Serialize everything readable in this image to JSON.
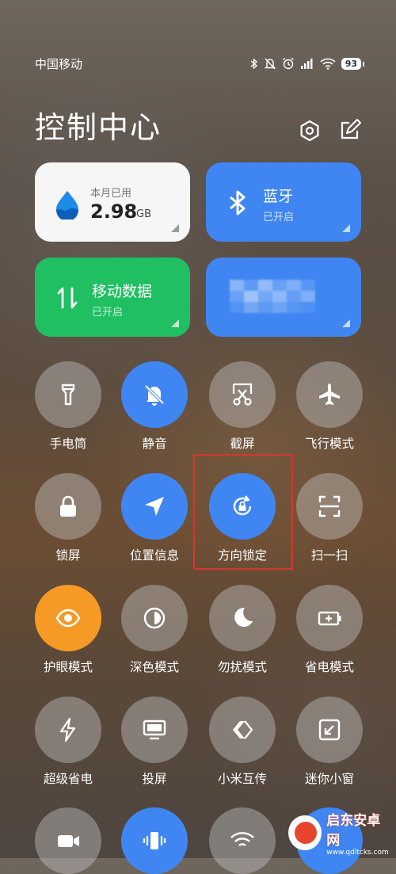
{
  "status_bar": {
    "carrier": "中国移动",
    "battery": "93"
  },
  "header": {
    "title": "控制中心"
  },
  "tiles": {
    "data_usage": {
      "label": "本月已用",
      "value": "2.98",
      "unit": "GB"
    },
    "bluetooth": {
      "label": "蓝牙",
      "status": "已开启"
    },
    "mobile_data": {
      "label": "移动数据",
      "status": "已开启"
    }
  },
  "buttons": [
    {
      "id": "flashlight",
      "label": "手电筒",
      "icon": "flashlight-icon",
      "state": "off"
    },
    {
      "id": "mute",
      "label": "静音",
      "icon": "bell-off-icon",
      "state": "on"
    },
    {
      "id": "screenshot",
      "label": "截屏",
      "icon": "scissors-icon",
      "state": "off"
    },
    {
      "id": "airplane",
      "label": "飞行模式",
      "icon": "airplane-icon",
      "state": "off"
    },
    {
      "id": "lock-screen",
      "label": "锁屏",
      "icon": "lock-icon",
      "state": "off"
    },
    {
      "id": "location",
      "label": "位置信息",
      "icon": "location-arrow-icon",
      "state": "on"
    },
    {
      "id": "rotation-lock",
      "label": "方向锁定",
      "icon": "rotation-lock-icon",
      "state": "on"
    },
    {
      "id": "scan",
      "label": "扫一扫",
      "icon": "scan-icon",
      "state": "off"
    },
    {
      "id": "eye-care",
      "label": "护眼模式",
      "icon": "eye-icon",
      "state": "on"
    },
    {
      "id": "dark-mode",
      "label": "深色模式",
      "icon": "contrast-icon",
      "state": "off"
    },
    {
      "id": "dnd",
      "label": "勿扰模式",
      "icon": "moon-icon",
      "state": "off"
    },
    {
      "id": "battery-saver",
      "label": "省电模式",
      "icon": "battery-icon",
      "state": "off"
    },
    {
      "id": "ultra-saver",
      "label": "超级省电",
      "icon": "lightning-icon",
      "state": "off"
    },
    {
      "id": "cast",
      "label": "投屏",
      "icon": "monitor-icon",
      "state": "off"
    },
    {
      "id": "mi-share",
      "label": "小米互传",
      "icon": "share-icon",
      "state": "off"
    },
    {
      "id": "mini-window",
      "label": "迷你小窗",
      "icon": "window-icon",
      "state": "off"
    }
  ],
  "partial_row": [
    {
      "icon": "video-icon",
      "state": "off"
    },
    {
      "icon": "vibrate-icon",
      "state": "on"
    },
    {
      "icon": "wifi-hotspot-icon",
      "state": "off"
    }
  ],
  "watermark": {
    "name": "启东安卓网",
    "url": "www.qdltcks.com"
  },
  "colors": {
    "blue": "#3f86f2",
    "green": "#1fbf62",
    "orange": "#f69a26",
    "highlight": "#d6372e"
  }
}
